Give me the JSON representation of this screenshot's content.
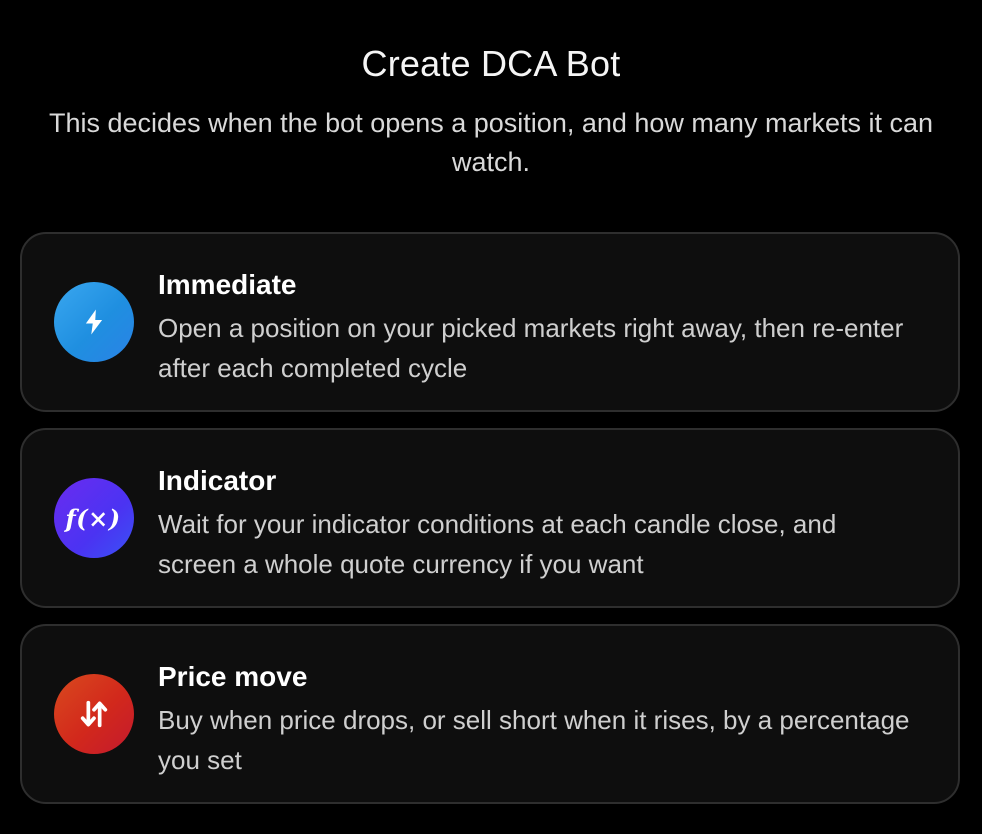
{
  "header": {
    "title": "Create DCA Bot",
    "subtitle": "This decides when the bot opens a position, and how many markets it can watch."
  },
  "options": [
    {
      "title": "Immediate",
      "description": "Open a position on your picked markets right away, then re-enter after each completed cycle",
      "icon": "bolt-icon",
      "icon_color": "#2196e8"
    },
    {
      "title": "Indicator",
      "description": "Wait for your indicator conditions at each candle close, and screen a whole quote currency if you want",
      "icon": "function-icon",
      "icon_glyph": "f(×)",
      "icon_color": "#5b2ff0"
    },
    {
      "title": "Price move",
      "description": "Buy when price drops, or sell short when it rises, by a percentage you set",
      "icon": "arrows-up-down-icon",
      "icon_color": "#d42a1e"
    }
  ]
}
